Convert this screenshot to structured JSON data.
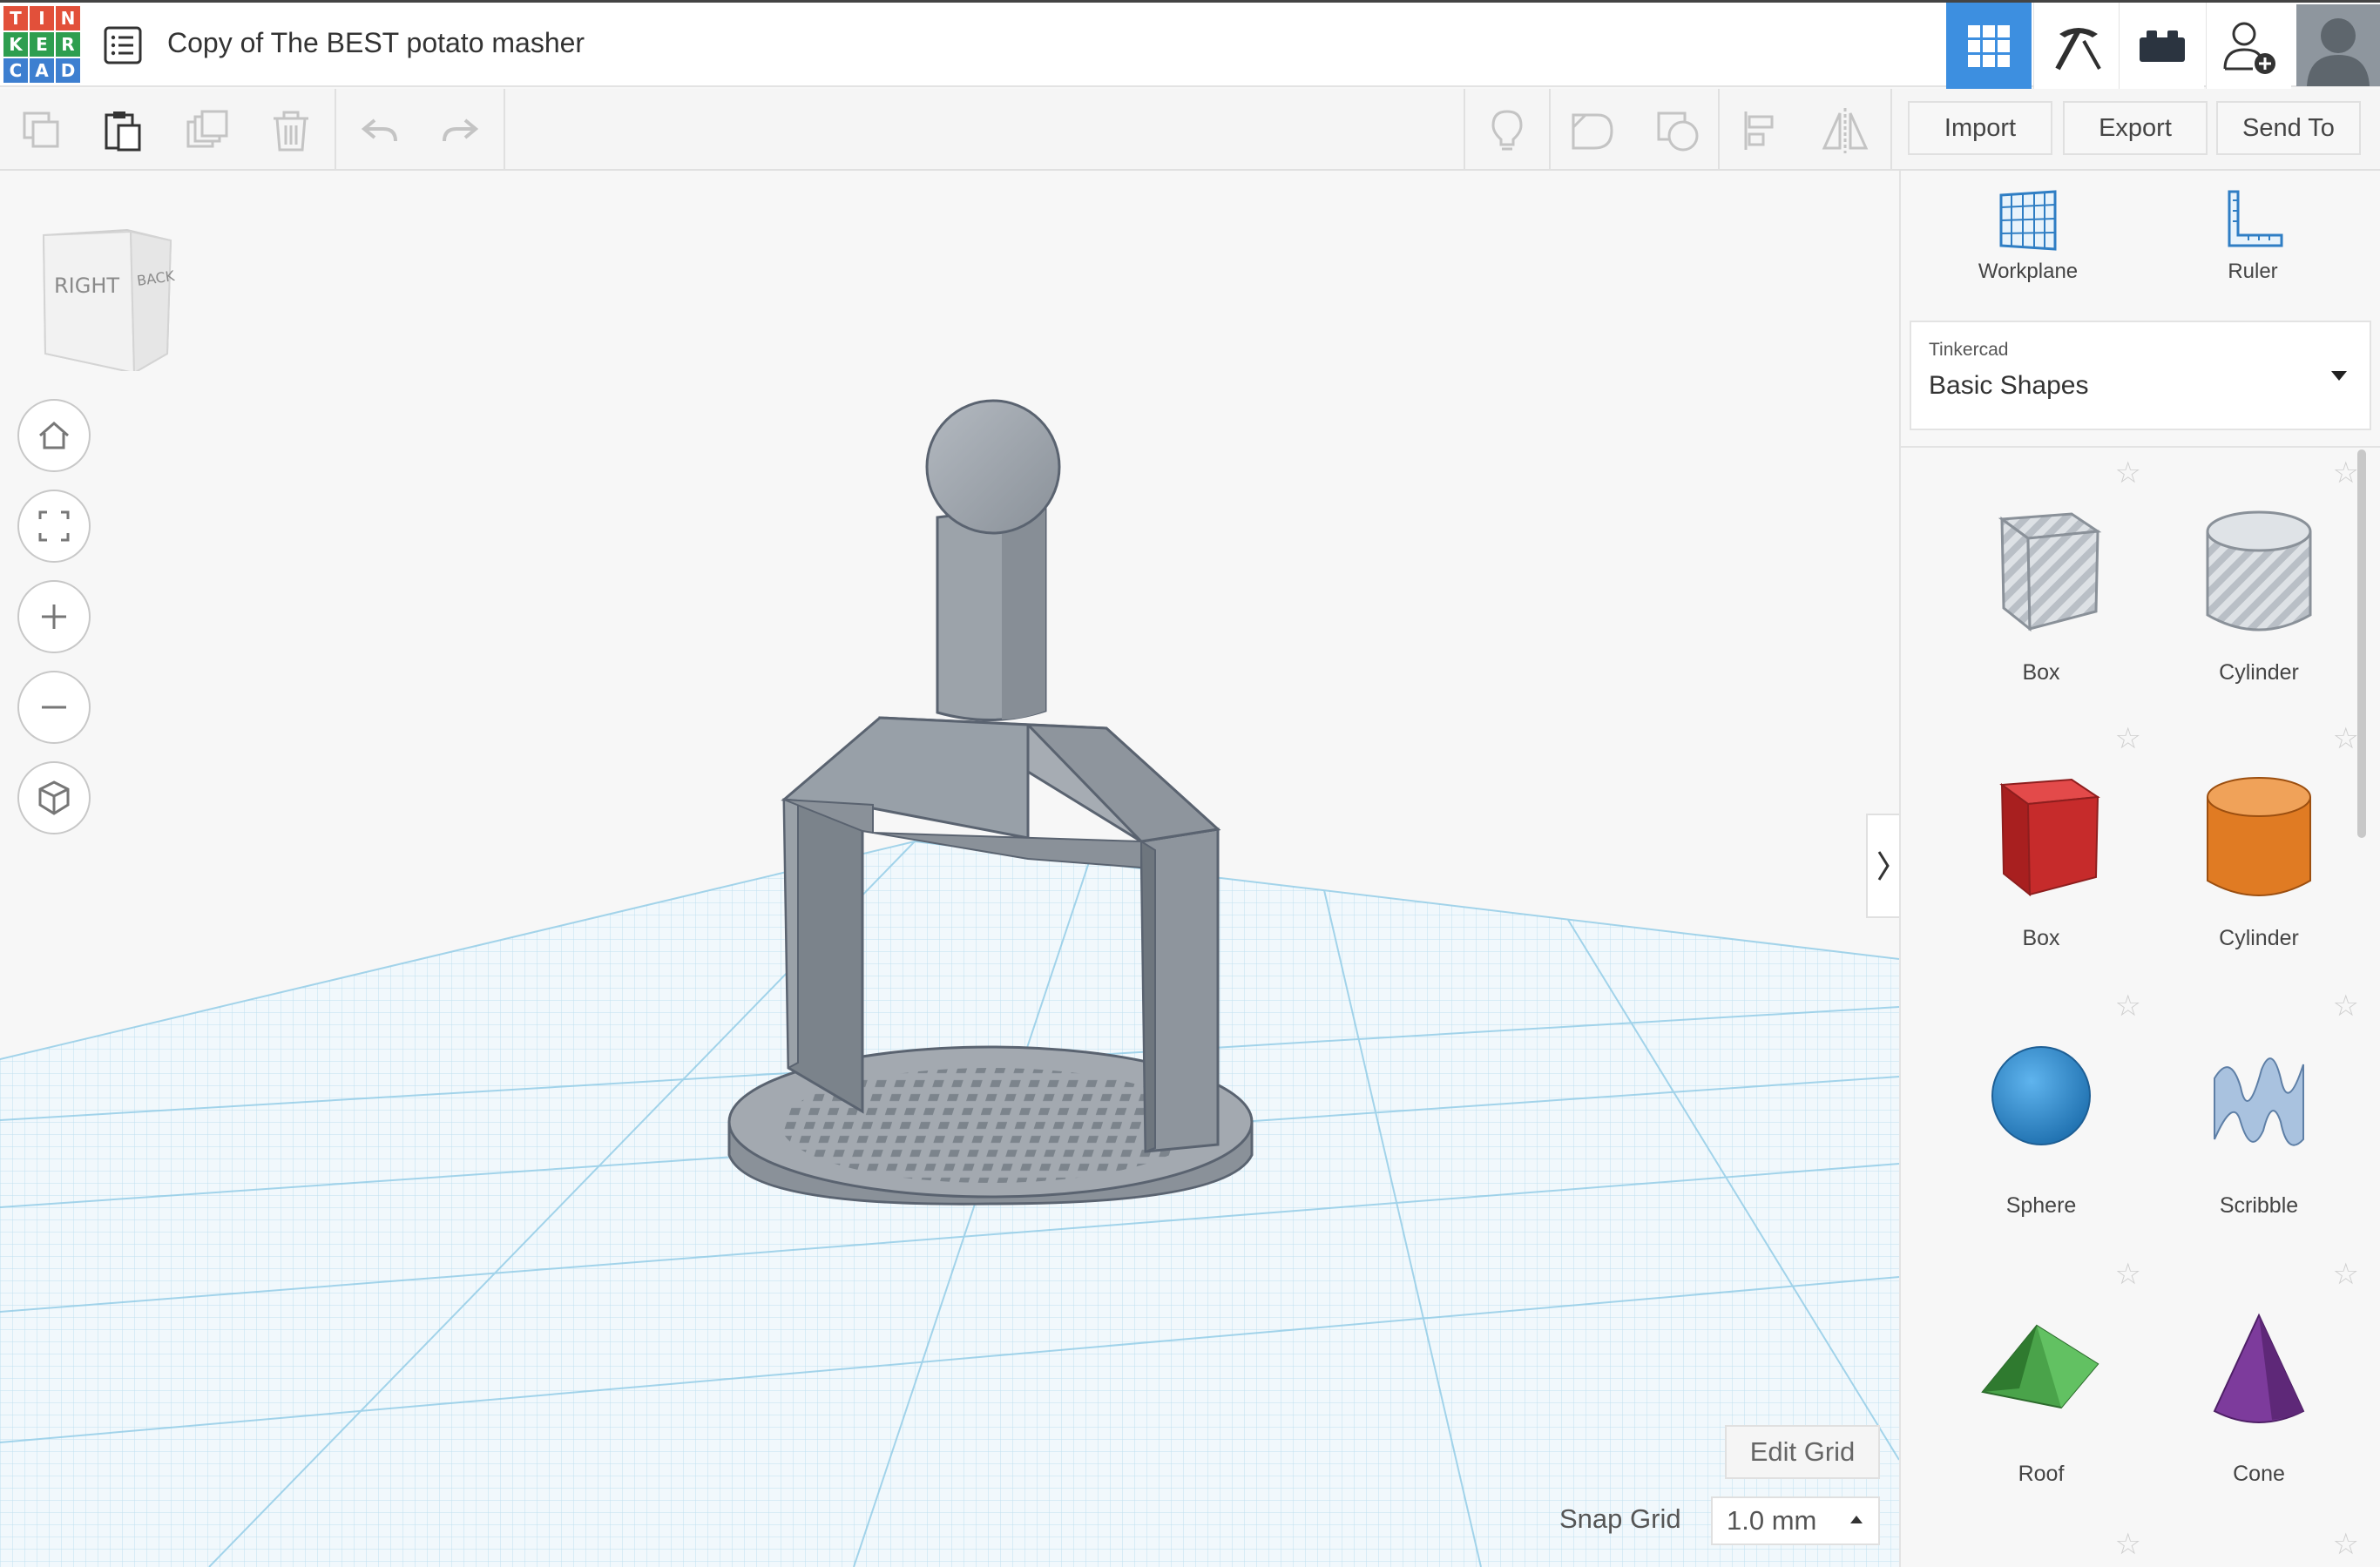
{
  "app": {
    "logo_letters": [
      "T",
      "I",
      "N",
      "K",
      "E",
      "R",
      "C",
      "A",
      "D"
    ],
    "logo_colors": [
      "#e2503a",
      "#e2503a",
      "#e2503a",
      "#2e9e4f",
      "#2e9e4f",
      "#2e9e4f",
      "#3d7fd0",
      "#3d7fd0",
      "#3d7fd0"
    ]
  },
  "header": {
    "title": "Copy of The BEST potato masher",
    "accent_color": "#3d8fe0"
  },
  "toolbar": {
    "import_label": "Import",
    "export_label": "Export",
    "send_to_label": "Send To"
  },
  "viewcube": {
    "right_label": "RIGHT",
    "back_label": "BACK"
  },
  "workplane": {
    "edit_grid_label": "Edit Grid",
    "snap_grid_label": "Snap Grid",
    "snap_grid_value": "1.0 mm"
  },
  "panel": {
    "tools": [
      {
        "label": "Workplane",
        "icon": "workplane-icon"
      },
      {
        "label": "Ruler",
        "icon": "ruler-icon"
      }
    ],
    "library_caption": "Tinkercad",
    "library_value": "Basic Shapes",
    "shapes": [
      {
        "label": "Box",
        "icon": "box-striped-icon"
      },
      {
        "label": "Cylinder",
        "icon": "cylinder-striped-icon"
      },
      {
        "label": "Box",
        "icon": "box-red-icon",
        "color": "#c62b2b"
      },
      {
        "label": "Cylinder",
        "icon": "cylinder-orange-icon",
        "color": "#e07b23"
      },
      {
        "label": "Sphere",
        "icon": "sphere-blue-icon",
        "color": "#2a8fd6"
      },
      {
        "label": "Scribble",
        "icon": "scribble-icon",
        "color": "#9fb9d9"
      },
      {
        "label": "Roof",
        "icon": "roof-green-icon",
        "color": "#4aa34a"
      },
      {
        "label": "Cone",
        "icon": "cone-purple-icon",
        "color": "#7d3b9c"
      }
    ]
  }
}
